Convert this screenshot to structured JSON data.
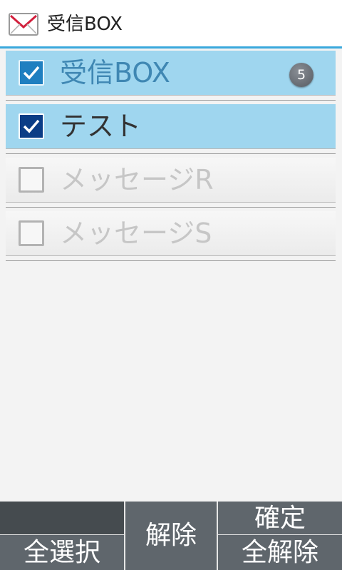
{
  "header": {
    "title": "受信BOX",
    "icon": "mail-icon"
  },
  "folders": [
    {
      "label": "受信BOX",
      "checked": true,
      "badge": "5",
      "state": "selected"
    },
    {
      "label": "テスト",
      "checked": true,
      "state": "selected"
    },
    {
      "label": "メッセージR",
      "checked": false,
      "state": "disabled"
    },
    {
      "label": "メッセージS",
      "checked": false,
      "state": "disabled"
    }
  ],
  "buttons": {
    "select_all": "全選択",
    "release": "解除",
    "confirm": "確定",
    "release_all": "全解除"
  },
  "colors": {
    "accent": "#3aa8dc",
    "selected_row": "#9fd6ef",
    "button_bg": "#5f666c"
  }
}
